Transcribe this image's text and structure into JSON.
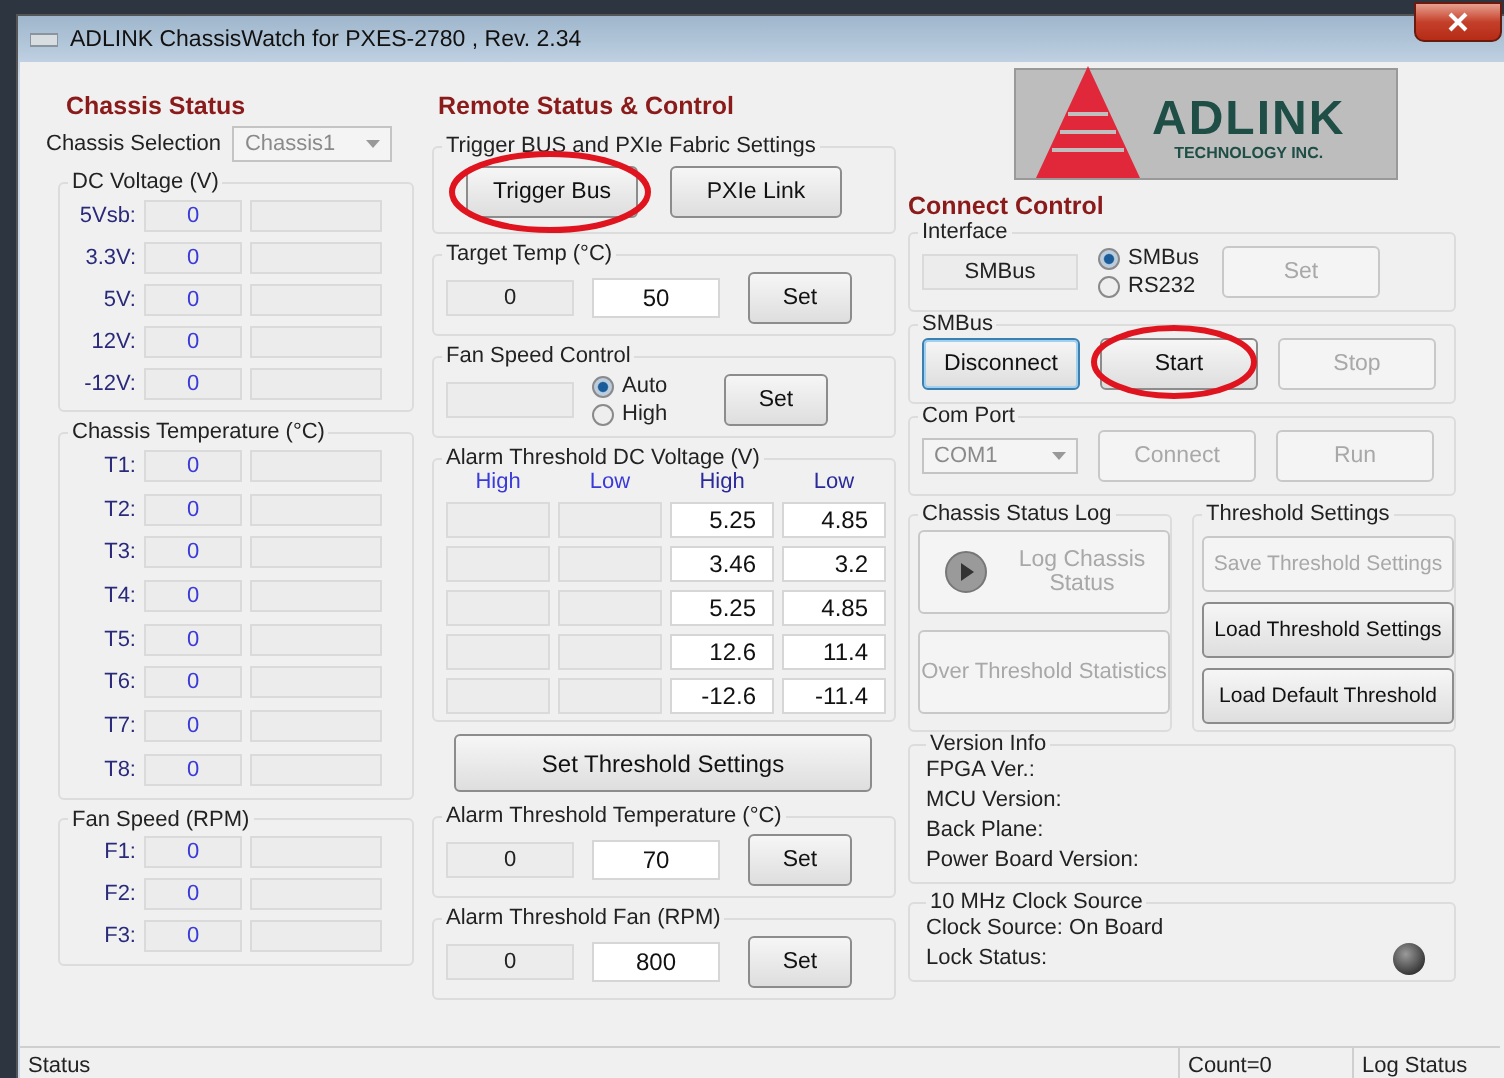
{
  "window": {
    "title": "ADLINK ChassisWatch for PXES-2780 , Rev. 2.34"
  },
  "chassis_status": {
    "heading": "Chassis Status",
    "selection_label": "Chassis Selection",
    "selection_value": "Chassis1",
    "groups": [
      {
        "title": "DC Voltage (V)",
        "rows": [
          {
            "label": "5Vsb:",
            "value": "0"
          },
          {
            "label": "3.3V:",
            "value": "0"
          },
          {
            "label": "5V:",
            "value": "0"
          },
          {
            "label": "12V:",
            "value": "0"
          },
          {
            "label": "-12V:",
            "value": "0"
          }
        ]
      },
      {
        "title": "Chassis Temperature (°C)",
        "rows": [
          {
            "label": "T1:",
            "value": "0"
          },
          {
            "label": "T2:",
            "value": "0"
          },
          {
            "label": "T3:",
            "value": "0"
          },
          {
            "label": "T4:",
            "value": "0"
          },
          {
            "label": "T5:",
            "value": "0"
          },
          {
            "label": "T6:",
            "value": "0"
          },
          {
            "label": "T7:",
            "value": "0"
          },
          {
            "label": "T8:",
            "value": "0"
          }
        ]
      },
      {
        "title": "Fan Speed (RPM)",
        "rows": [
          {
            "label": "F1:",
            "value": "0"
          },
          {
            "label": "F2:",
            "value": "0"
          },
          {
            "label": "F3:",
            "value": "0"
          }
        ]
      }
    ]
  },
  "remote": {
    "heading": "Remote Status & Control",
    "trigger": {
      "title": "Trigger BUS and PXIe Fabric Settings",
      "buttons": [
        {
          "label": "Trigger Bus",
          "circled": true
        },
        {
          "label": "PXIe Link",
          "circled": false
        }
      ]
    },
    "target_temp": {
      "title": "Target Temp (°C)",
      "reading": "0",
      "value": "50",
      "button": "Set"
    },
    "fan_control": {
      "title": "Fan Speed Control",
      "options": [
        {
          "label": "Auto",
          "selected": true
        },
        {
          "label": "High",
          "selected": false
        }
      ],
      "button": "Set"
    },
    "alarm_dc": {
      "title": "Alarm Threshold DC Voltage (V)",
      "headers": [
        "High",
        "Low",
        "High",
        "Low"
      ],
      "rows": [
        {
          "high": "5.25",
          "low": "4.85"
        },
        {
          "high": "3.46",
          "low": "3.2"
        },
        {
          "high": "5.25",
          "low": "4.85"
        },
        {
          "high": "12.6",
          "low": "11.4"
        },
        {
          "high": "-12.6",
          "low": "-11.4"
        }
      ]
    },
    "set_threshold": "Set Threshold Settings",
    "alarm_temp": {
      "title": "Alarm Threshold Temperature (°C)",
      "reading": "0",
      "value": "70",
      "button": "Set"
    },
    "alarm_fan": {
      "title": "Alarm Threshold Fan (RPM)",
      "reading": "0",
      "value": "800",
      "button": "Set"
    }
  },
  "logo": {
    "name": "ADLINK",
    "tagline": "TECHNOLOGY INC."
  },
  "connect": {
    "heading": "Connect Control",
    "interface": {
      "title": "Interface",
      "value": "SMBus",
      "options": [
        {
          "label": "SMBus",
          "selected": true
        },
        {
          "label": "RS232",
          "selected": false
        }
      ],
      "button": {
        "label": "Set",
        "disabled": true
      }
    },
    "smbus": {
      "title": "SMBus",
      "buttons": [
        {
          "label": "Disconnect",
          "disabled": false,
          "focused": true,
          "circled": false
        },
        {
          "label": "Start",
          "disabled": false,
          "focused": false,
          "circled": true
        },
        {
          "label": "Stop",
          "disabled": true,
          "focused": false,
          "circled": false
        }
      ]
    },
    "com_port": {
      "title": "Com Port",
      "value": "COM1",
      "buttons": [
        {
          "label": "Connect",
          "disabled": true
        },
        {
          "label": "Run",
          "disabled": true
        }
      ]
    }
  },
  "log": {
    "title": "Chassis Status Log",
    "log_button": {
      "label": "Log Chassis Status",
      "disabled": true
    },
    "stats_button": {
      "label": "Over Threshold Statistics",
      "disabled": true
    }
  },
  "threshold_settings": {
    "title": "Threshold Settings",
    "buttons": [
      {
        "label": "Save Threshold Settings",
        "disabled": true
      },
      {
        "label": "Load Threshold Settings",
        "disabled": false
      },
      {
        "label": "Load Default Threshold",
        "disabled": false
      }
    ]
  },
  "version_info": {
    "title": "Version Info",
    "lines": [
      "FPGA Ver.:",
      "MCU Version:",
      "Back Plane:",
      "Power Board Version:"
    ]
  },
  "clock": {
    "title": "10 MHz Clock Source",
    "lines": [
      "Clock Source: On Board",
      "Lock Status:"
    ]
  },
  "status_bar": [
    "Status",
    "Count=0",
    "Log Status"
  ]
}
